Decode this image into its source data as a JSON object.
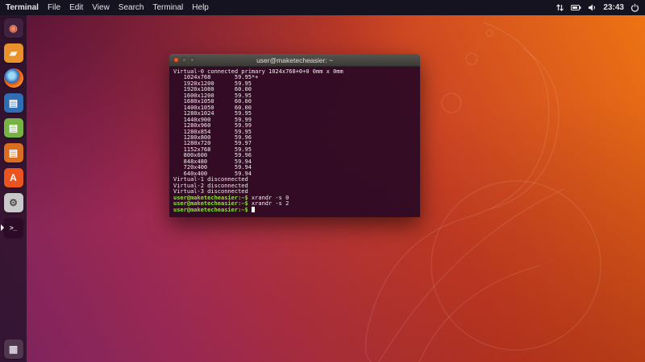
{
  "menubar": {
    "app_name": "Terminal",
    "menus": [
      "File",
      "Edit",
      "View",
      "Search",
      "Terminal",
      "Help"
    ],
    "clock": "23:43",
    "indicators": [
      "network-icon",
      "battery-icon",
      "sound-icon",
      "clock",
      "power-icon"
    ]
  },
  "launcher": {
    "items": [
      {
        "name": "dash-home",
        "glyph": "◉",
        "fg": "#f08763",
        "bg": "#42203f",
        "shape": "square"
      },
      {
        "name": "files",
        "glyph": "▰",
        "fg": "#fff3df",
        "bg": "#e8912d",
        "shape": "square"
      },
      {
        "name": "firefox",
        "glyph": "",
        "fg": "#ffffff",
        "bg": "radial-gradient(circle at 40% 38%, #9fd9f6 18%, #2a6bbf 42%, #e3590b 48%, #ff9640 78%, #d84a05 100%)",
        "shape": "circle"
      },
      {
        "name": "libreoffice-writer",
        "glyph": "▤",
        "fg": "#ffffff",
        "bg": "#2f6eb5",
        "shape": "square"
      },
      {
        "name": "libreoffice-calc",
        "glyph": "▤",
        "fg": "#ffffff",
        "bg": "#77b245",
        "shape": "square"
      },
      {
        "name": "libreoffice-impress",
        "glyph": "▤",
        "fg": "#ffffff",
        "bg": "#d96e20",
        "shape": "square"
      },
      {
        "name": "ubuntu-software",
        "glyph": "A",
        "fg": "#ffffff",
        "bg": "#e95420",
        "shape": "square"
      },
      {
        "name": "system-settings",
        "glyph": "⚙",
        "fg": "#4a4a4a",
        "bg": "#c9c9c9",
        "shape": "square"
      },
      {
        "name": "terminal",
        "glyph": ">_",
        "fg": "#e6e6e6",
        "bg": "#2d0a26",
        "shape": "square",
        "active": true
      },
      {
        "name": "show-applications",
        "glyph": "▦",
        "fg": "#d9d3dd",
        "bg": "rgba(255,255,255,0.14)",
        "shape": "square",
        "pin_bottom": true
      }
    ]
  },
  "terminal": {
    "title": "user@maketecheasier: ~",
    "lines": [
      {
        "text": "Virtual-0 connected primary 1024x768+0+0 0mm x 0mm"
      },
      {
        "text": "   1024x768       59.95*+"
      },
      {
        "text": "   1920x1200      59.95"
      },
      {
        "text": "   1920x1080      60.00"
      },
      {
        "text": "   1600x1200      59.95"
      },
      {
        "text": "   1680x1050      60.00"
      },
      {
        "text": "   1400x1050      60.00"
      },
      {
        "text": "   1280x1024      59.95"
      },
      {
        "text": "   1440x900       59.99"
      },
      {
        "text": "   1280x960       59.99"
      },
      {
        "text": "   1280x854       59.95"
      },
      {
        "text": "   1280x800       59.96"
      },
      {
        "text": "   1280x720       59.97"
      },
      {
        "text": "   1152x768       59.95"
      },
      {
        "text": "   800x600        59.96"
      },
      {
        "text": "   848x480        59.94"
      },
      {
        "text": "   720x400        59.94"
      },
      {
        "text": "   640x400        59.94"
      },
      {
        "text": "Virtual-1 disconnected"
      },
      {
        "text": "Virtual-2 disconnected"
      },
      {
        "text": "Virtual-3 disconnected"
      },
      {
        "prompt": "user@maketecheasier:~$",
        "cmd": " xrandr -s 0"
      },
      {
        "prompt": "user@maketecheasier:~$",
        "cmd": " xrandr -s 2"
      },
      {
        "prompt": "user@maketecheasier:~$",
        "cmd": "",
        "cursor": true
      }
    ]
  },
  "colors": {
    "prompt_green": "#8ae234",
    "terminal_bg": "#300a24",
    "accent_orange": "#e95420",
    "wallpaper_purple": "#7b2360"
  }
}
